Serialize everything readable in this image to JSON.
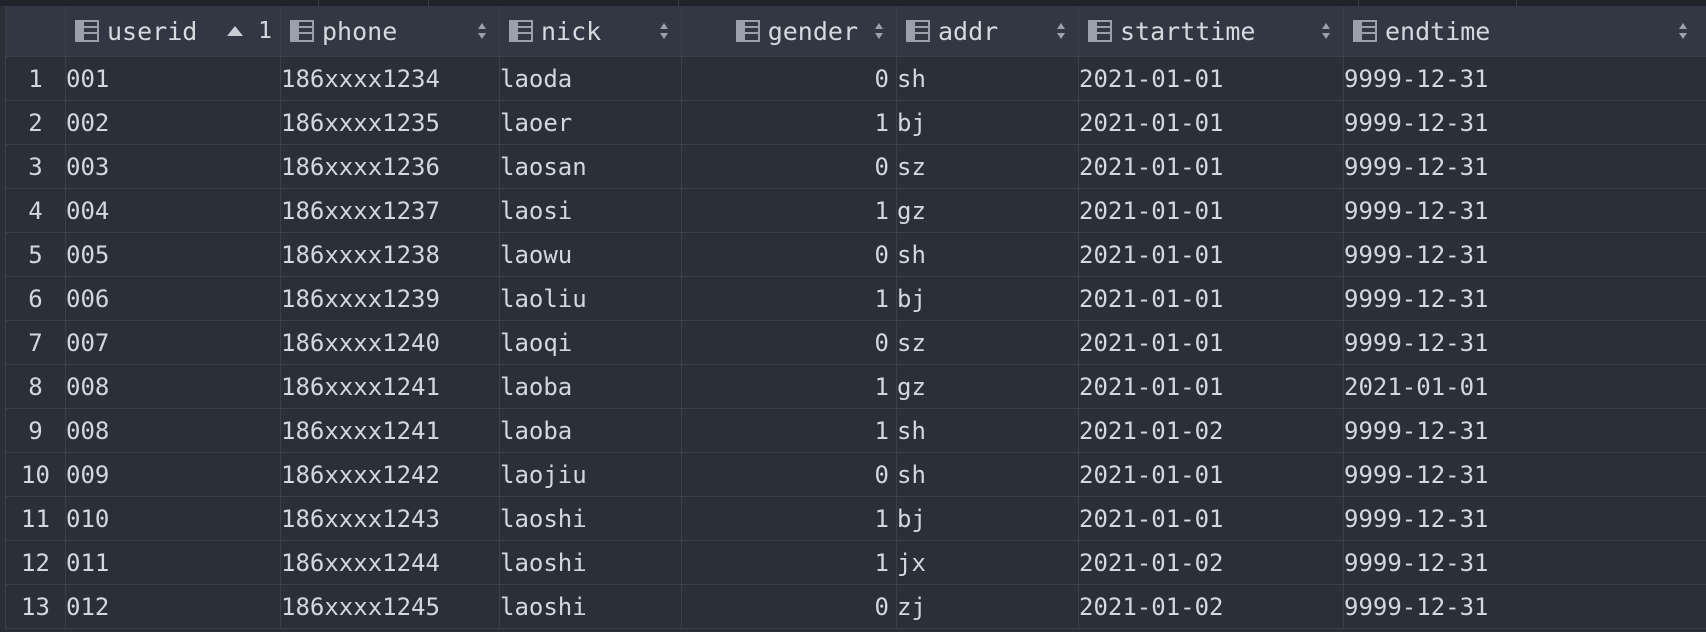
{
  "table": {
    "columns": [
      {
        "key": "userid",
        "label": "userid",
        "sort": "asc",
        "sort_order": "1"
      },
      {
        "key": "phone",
        "label": "phone",
        "sort": "none"
      },
      {
        "key": "nick",
        "label": "nick",
        "sort": "none"
      },
      {
        "key": "gender",
        "label": "gender",
        "sort": "none"
      },
      {
        "key": "addr",
        "label": "addr",
        "sort": "none"
      },
      {
        "key": "starttime",
        "label": "starttime",
        "sort": "none"
      },
      {
        "key": "endtime",
        "label": "endtime",
        "sort": "none"
      }
    ],
    "rows": [
      {
        "num": "1",
        "userid": "001",
        "phone": "186xxxx1234",
        "nick": "laoda",
        "gender": "0",
        "addr": "sh",
        "starttime": "2021-01-01",
        "endtime": "9999-12-31"
      },
      {
        "num": "2",
        "userid": "002",
        "phone": "186xxxx1235",
        "nick": "laoer",
        "gender": "1",
        "addr": "bj",
        "starttime": "2021-01-01",
        "endtime": "9999-12-31"
      },
      {
        "num": "3",
        "userid": "003",
        "phone": "186xxxx1236",
        "nick": "laosan",
        "gender": "0",
        "addr": "sz",
        "starttime": "2021-01-01",
        "endtime": "9999-12-31"
      },
      {
        "num": "4",
        "userid": "004",
        "phone": "186xxxx1237",
        "nick": "laosi",
        "gender": "1",
        "addr": "gz",
        "starttime": "2021-01-01",
        "endtime": "9999-12-31"
      },
      {
        "num": "5",
        "userid": "005",
        "phone": "186xxxx1238",
        "nick": "laowu",
        "gender": "0",
        "addr": "sh",
        "starttime": "2021-01-01",
        "endtime": "9999-12-31"
      },
      {
        "num": "6",
        "userid": "006",
        "phone": "186xxxx1239",
        "nick": "laoliu",
        "gender": "1",
        "addr": "bj",
        "starttime": "2021-01-01",
        "endtime": "9999-12-31"
      },
      {
        "num": "7",
        "userid": "007",
        "phone": "186xxxx1240",
        "nick": "laoqi",
        "gender": "0",
        "addr": "sz",
        "starttime": "2021-01-01",
        "endtime": "9999-12-31"
      },
      {
        "num": "8",
        "userid": "008",
        "phone": "186xxxx1241",
        "nick": "laoba",
        "gender": "1",
        "addr": "gz",
        "starttime": "2021-01-01",
        "endtime": "2021-01-01"
      },
      {
        "num": "9",
        "userid": "008",
        "phone": "186xxxx1241",
        "nick": "laoba",
        "gender": "1",
        "addr": "sh",
        "starttime": "2021-01-02",
        "endtime": "9999-12-31"
      },
      {
        "num": "10",
        "userid": "009",
        "phone": "186xxxx1242",
        "nick": "laojiu",
        "gender": "0",
        "addr": "sh",
        "starttime": "2021-01-01",
        "endtime": "9999-12-31"
      },
      {
        "num": "11",
        "userid": "010",
        "phone": "186xxxx1243",
        "nick": "laoshi",
        "gender": "1",
        "addr": "bj",
        "starttime": "2021-01-01",
        "endtime": "9999-12-31"
      },
      {
        "num": "12",
        "userid": "011",
        "phone": "186xxxx1244",
        "nick": "laoshi",
        "gender": "1",
        "addr": "jx",
        "starttime": "2021-01-02",
        "endtime": "9999-12-31"
      },
      {
        "num": "13",
        "userid": "012",
        "phone": "186xxxx1245",
        "nick": "laoshi",
        "gender": "0",
        "addr": "zj",
        "starttime": "2021-01-02",
        "endtime": "9999-12-31"
      }
    ]
  },
  "icons": {
    "column": "table-column-icon",
    "sort_asc": "sort-ascending-icon",
    "sort_none": "sort-updown-icon"
  },
  "colors": {
    "background": "#2b2f38",
    "header_background": "#323743",
    "grid_line": "#3b414c",
    "text": "#d4d8de",
    "icon": "#9aa1ad"
  }
}
